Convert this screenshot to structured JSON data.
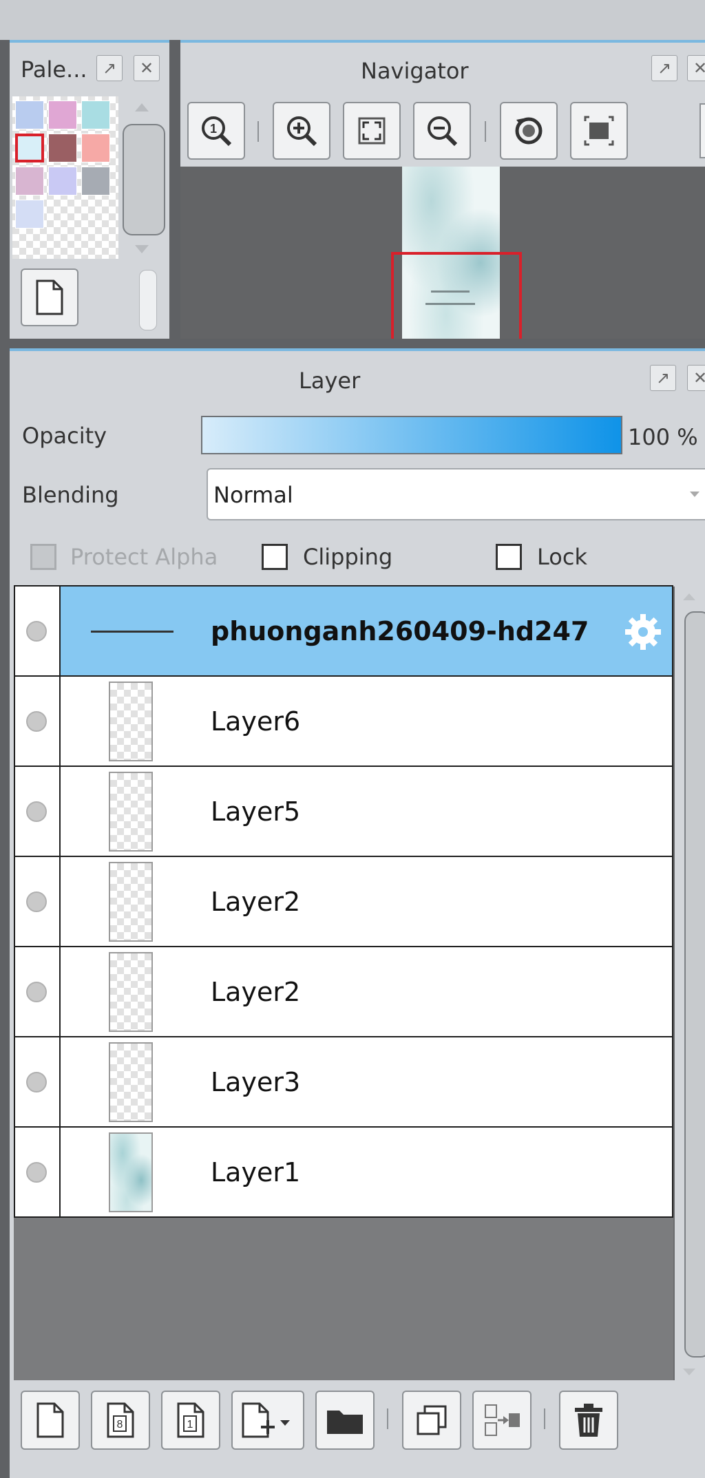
{
  "palette_panel": {
    "title": "Pale...",
    "popout_icon": "popout-icon",
    "close_icon": "close-icon",
    "swatches": [
      [
        "#b9ccef",
        "#e0a7d4",
        "#a9dde3"
      ],
      [
        "#d8eff8",
        "#9a5f63",
        "#f6a9a6"
      ],
      [
        "#d8b5d1",
        "#c9c9f4",
        "#a6abb3"
      ],
      [
        "#d4ddf5"
      ]
    ],
    "selected_swatch": "#d8eff8",
    "new_swatch_icon": "new-page-icon"
  },
  "navigator": {
    "title": "Navigator",
    "tools": [
      "actual-size-zoom-icon",
      "zoom-in-icon",
      "fit-window-icon",
      "zoom-out-icon",
      "rotate-icon",
      "fullscreen-icon"
    ]
  },
  "layer_panel": {
    "title": "Layer",
    "opacity_label": "Opacity",
    "opacity_value": "100 %",
    "opacity_level": 1.0,
    "blending_label": "Blending",
    "blending_value": "Normal",
    "protect_alpha_label": "Protect Alpha",
    "clipping_label": "Clipping",
    "lock_label": "Lock",
    "layers": [
      {
        "name": "phuonganh260409-hd247",
        "selected": true
      },
      {
        "name": "Layer6",
        "selected": false
      },
      {
        "name": "Layer5",
        "selected": false
      },
      {
        "name": "Layer2",
        "selected": false
      },
      {
        "name": "Layer2",
        "selected": false
      },
      {
        "name": "Layer3",
        "selected": false
      },
      {
        "name": "Layer1",
        "selected": false
      }
    ],
    "layer_settings_icon": "gear-icon",
    "bottom_tools": [
      "new-layer-icon",
      "new-8bit-layer-icon",
      "new-1bit-layer-icon",
      "add-layer-menu-icon",
      "new-folder-icon",
      "duplicate-layer-icon",
      "merge-layer-icon",
      "delete-layer-icon"
    ]
  },
  "colors": {
    "accent": "#7ab8e0",
    "selected_row": "#86c8f2",
    "opacity_bar_start": "#d7ecfa",
    "opacity_bar_end": "#0f93e8",
    "canvas_bg": "#636466",
    "nav_frame": "#d9202a"
  }
}
